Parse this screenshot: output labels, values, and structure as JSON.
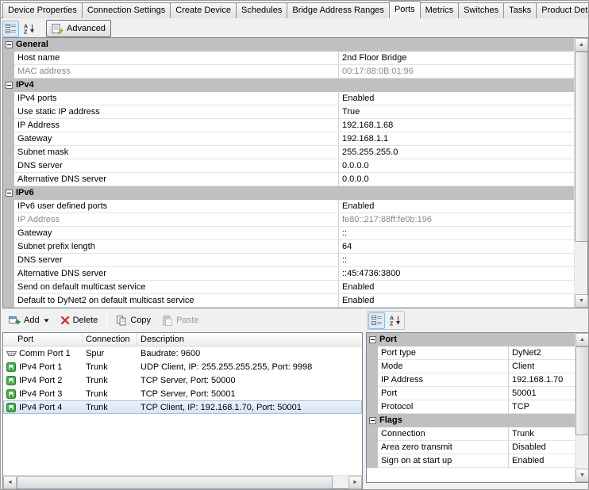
{
  "tabs": [
    "Device Properties",
    "Connection Settings",
    "Create Device",
    "Schedules",
    "Bridge Address Ranges",
    "Ports",
    "Metrics",
    "Switches",
    "Tasks",
    "Product Details"
  ],
  "active_tab": "Ports",
  "toolbar": {
    "advanced_label": "Advanced"
  },
  "property_grid": {
    "categories": [
      {
        "name": "General",
        "rows": [
          {
            "label": "Host name",
            "value": "2nd Floor Bridge",
            "readonly": false
          },
          {
            "label": "MAC address",
            "value": "00:17:88:0B:01:96",
            "readonly": true
          }
        ]
      },
      {
        "name": "IPv4",
        "rows": [
          {
            "label": "IPv4 ports",
            "value": "Enabled",
            "readonly": false
          },
          {
            "label": "Use static IP address",
            "value": "True",
            "readonly": false
          },
          {
            "label": "IP Address",
            "value": "192.168.1.68",
            "readonly": false
          },
          {
            "label": "Gateway",
            "value": "192.168.1.1",
            "readonly": false
          },
          {
            "label": "Subnet mask",
            "value": "255.255.255.0",
            "readonly": false
          },
          {
            "label": "DNS server",
            "value": "0.0.0.0",
            "readonly": false
          },
          {
            "label": "Alternative DNS server",
            "value": "0.0.0.0",
            "readonly": false
          }
        ]
      },
      {
        "name": "IPv6",
        "rows": [
          {
            "label": "IPv6 user defined ports",
            "value": "Enabled",
            "readonly": false
          },
          {
            "label": "IP Address",
            "value": "fe80::217:88ff:fe0b:196",
            "readonly": true
          },
          {
            "label": "Gateway",
            "value": "::",
            "readonly": false
          },
          {
            "label": "Subnet prefix length",
            "value": "64",
            "readonly": false
          },
          {
            "label": "DNS server",
            "value": "::",
            "readonly": false
          },
          {
            "label": "Alternative DNS server",
            "value": "::45:4736:3800",
            "readonly": false
          },
          {
            "label": "Send on default multicast service",
            "value": "Enabled",
            "readonly": false
          },
          {
            "label": "Default to DyNet2 on default multicast service",
            "value": "Enabled",
            "readonly": false
          }
        ]
      }
    ]
  },
  "ports_toolbar": {
    "add_label": "Add",
    "delete_label": "Delete",
    "copy_label": "Copy",
    "paste_label": "Paste"
  },
  "ports_list": {
    "columns": [
      "Port",
      "Connection",
      "Description"
    ],
    "rows": [
      {
        "icon": "serial-port-icon",
        "port": "Comm Port 1",
        "connection": "Spur",
        "description": "Baudrate: 9600",
        "selected": false
      },
      {
        "icon": "network-port-icon",
        "port": "IPv4 Port 1",
        "connection": "Trunk",
        "description": "UDP Client, IP: 255.255.255.255, Port: 9998",
        "selected": false
      },
      {
        "icon": "network-port-icon",
        "port": "IPv4 Port 2",
        "connection": "Trunk",
        "description": "TCP Server, Port: 50000",
        "selected": false
      },
      {
        "icon": "network-port-icon",
        "port": "IPv4 Port 3",
        "connection": "Trunk",
        "description": "TCP Server, Port: 50001",
        "selected": false
      },
      {
        "icon": "network-port-icon",
        "port": "IPv4 Port 4",
        "connection": "Trunk",
        "description": "TCP Client, IP: 192.168.1.70, Port: 50001",
        "selected": true
      }
    ]
  },
  "port_grid": {
    "categories": [
      {
        "name": "Port",
        "rows": [
          {
            "label": "Port type",
            "value": "DyNet2",
            "readonly": false
          },
          {
            "label": "Mode",
            "value": "Client",
            "readonly": false
          },
          {
            "label": "IP Address",
            "value": "192.168.1.70",
            "readonly": false
          },
          {
            "label": "Port",
            "value": "50001",
            "readonly": false
          },
          {
            "label": "Protocol",
            "value": "TCP",
            "readonly": false
          }
        ]
      },
      {
        "name": "Flags",
        "rows": [
          {
            "label": "Connection",
            "value": "Trunk",
            "readonly": false
          },
          {
            "label": "Area zero transmit",
            "value": "Disabled",
            "readonly": false
          },
          {
            "label": "Sign on at start up",
            "value": "Enabled",
            "readonly": false
          }
        ]
      }
    ]
  }
}
